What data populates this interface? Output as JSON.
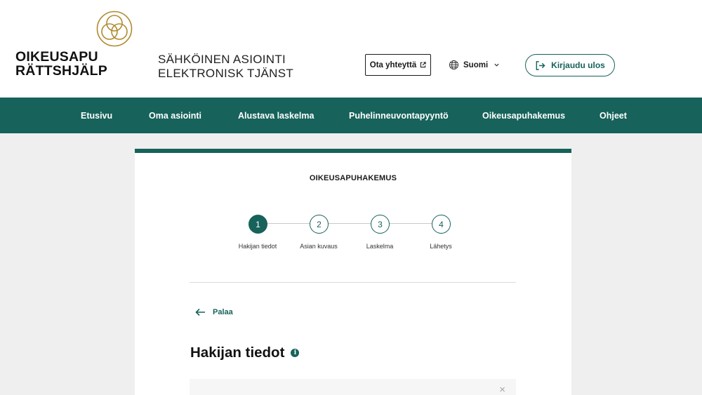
{
  "header": {
    "logo_line1": "OIKEUSAPU",
    "logo_line2": "RÄTTSHJÄLP",
    "service_line1": "SÄHKÖINEN ASIOINTI",
    "service_line2": "ELEKTRONISK TJÄNST",
    "contact_label": "Ota yhteyttä",
    "language_label": "Suomi",
    "logout_label": "Kirjaudu ulos"
  },
  "nav": {
    "items": [
      {
        "label": "Etusivu"
      },
      {
        "label": "Oma asiointi"
      },
      {
        "label": "Alustava laskelma"
      },
      {
        "label": "Puhelinneuvontapyyntö"
      },
      {
        "label": "Oikeusapuhakemus"
      },
      {
        "label": "Ohjeet"
      }
    ]
  },
  "form": {
    "title": "OIKEUSAPUHAKEMUS",
    "steps": [
      {
        "number": "1",
        "label": "Hakijan tiedot",
        "state": "active"
      },
      {
        "number": "2",
        "label": "Asian kuvaus",
        "state": "pending"
      },
      {
        "number": "3",
        "label": "Laskelma",
        "state": "pending"
      },
      {
        "number": "4",
        "label": "Lähetys",
        "state": "pending"
      }
    ],
    "back_label": "Palaa",
    "section_title": "Hakijan tiedot",
    "info_icon_glyph": "i",
    "close_glyph": "×"
  },
  "colors": {
    "brand": "#17625b",
    "logo_gold": "#b08a2e",
    "background": "#efefef"
  },
  "icons": {
    "logo": "triquetra-circle-icon",
    "external_link": "external-link-icon",
    "globe": "globe-icon",
    "chevron": "chevron-down-icon",
    "logout": "logout-icon",
    "back": "arrow-left-icon",
    "info": "info-icon",
    "close": "close-icon"
  }
}
